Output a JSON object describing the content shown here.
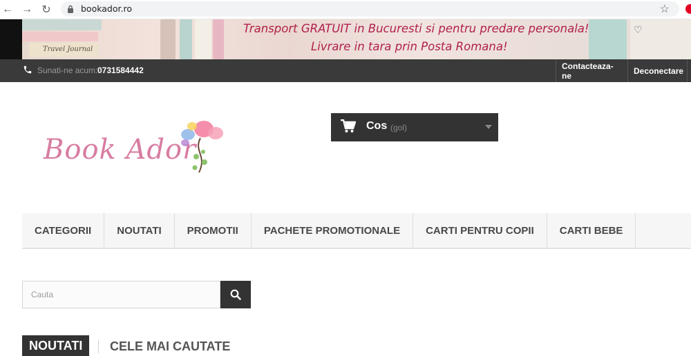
{
  "browser": {
    "url": "bookador.ro"
  },
  "banner": {
    "line1": "Transport GRATUIT in Bucuresti si pentru predare personala!",
    "line2": "Livrare in tara prin Posta Romana!",
    "journal_text": "Travel Journal"
  },
  "topbar": {
    "phone_label": "Sunati-ne acum:",
    "phone_number": "0731584442",
    "contact_label": "Contacteaza-ne",
    "logout_label": "Deconectare"
  },
  "logo": {
    "text": "Book Ador"
  },
  "cart": {
    "label": "Cos",
    "count_text": "(gol)"
  },
  "menu": {
    "items": [
      {
        "label": "CATEGORII"
      },
      {
        "label": "NOUTATI"
      },
      {
        "label": "PROMOTII"
      },
      {
        "label": "PACHETE PROMOTIONALE"
      },
      {
        "label": "CARTI PENTRU COPII"
      },
      {
        "label": "CARTI BEBE"
      }
    ]
  },
  "search": {
    "placeholder": "Cauta"
  },
  "tabs": {
    "active": "NOUTATI",
    "other": "CELE MAI CAUTATE"
  },
  "colors": {
    "accent_dark": "#333333",
    "banner_text": "#b0204a",
    "logo_pink": "#d87ca2"
  }
}
